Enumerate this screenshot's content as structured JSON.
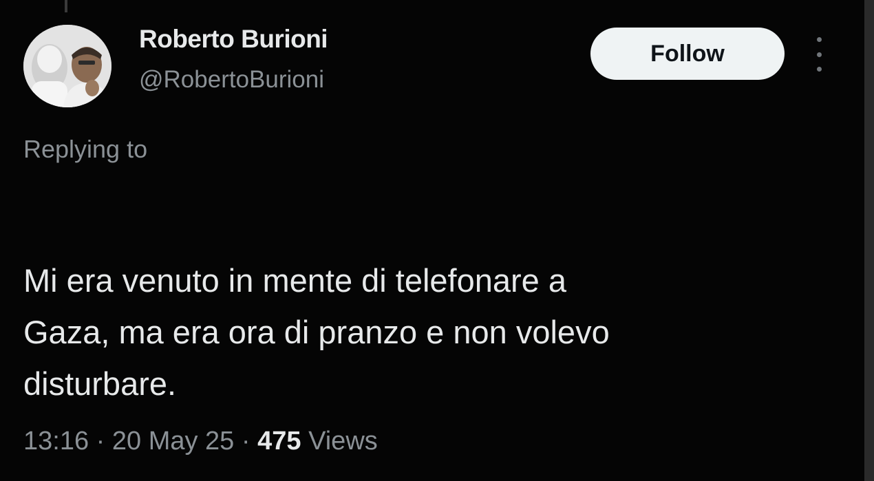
{
  "author": {
    "name": "Roberto Burioni",
    "handle": "@RobertoBurioni"
  },
  "actions": {
    "follow_label": "Follow",
    "more_icon": "more-vertical-icon"
  },
  "reply_context": {
    "label": "Replying to"
  },
  "tweet": {
    "lines": [
      "Mi era venuto in mente di telefonare a",
      "Gaza, ma era ora di pranzo e non volevo",
      "disturbare."
    ]
  },
  "meta": {
    "time": "13:16",
    "separator": " · ",
    "date": "20 May 25",
    "views_count": "475",
    "views_label": "Views"
  },
  "colors": {
    "background": "#050505",
    "primary_text": "#e7e9ea",
    "secondary_text": "#8b9196",
    "follow_button_bg": "#eff3f4"
  }
}
